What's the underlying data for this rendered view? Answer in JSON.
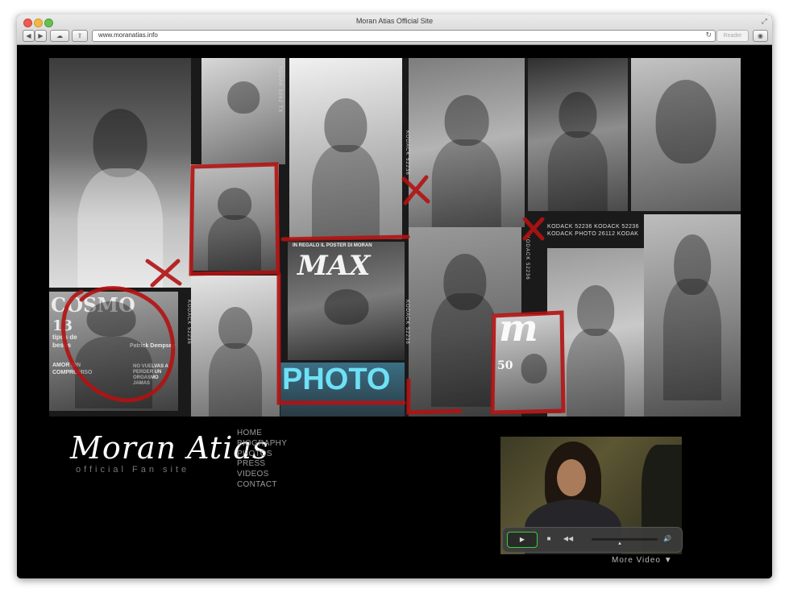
{
  "window": {
    "title": "Moran Atias Official Site",
    "url": "www.moranatias.info",
    "reader_label": "Reader",
    "toolbar_back": "◀",
    "toolbar_forward": "▶",
    "toolbar_cloud": "☁",
    "toolbar_share": "⇪",
    "reload_icon": "↻",
    "fullscreen_icon": "⤢",
    "downloads_icon": "◉"
  },
  "collage": {
    "magazine_max_banner": "IN REGALO IL POSTER DI MORAN",
    "magazine_max_title": "MAX",
    "magazine_cosmo_title": "COSMO",
    "magazine_cosmo_number": "13",
    "magazine_cosmo_line1": "tipos de",
    "magazine_cosmo_line2": "besos",
    "magazine_cosmo_line3": "AMOR SIN",
    "magazine_cosmo_line4": "COMPROMISO",
    "magazine_cosmo_line5": "Patrick Dempsey",
    "magazine_cosmo_line6": "NO VUELVAS A PERDER UN ORGASMO JAMAS",
    "magazine_photo_title": "PHOTO",
    "magazine_m_title": "m",
    "magazine_m_number": "50",
    "kodak_line1": "KODACK 52236 KODACK 52236",
    "kodak_line2": "KODACK PHOTO 26112 KODAK",
    "film_text": "KODACK 52236",
    "film_text_2": "KODAK 5062 TX",
    "film_text_3": "KODACK 52236"
  },
  "site": {
    "logo": "Moran Atias",
    "tagline": "official Fan site"
  },
  "nav": {
    "items": [
      "HOME",
      "BIOGRAPHY",
      "PHOTOS",
      "PRESS",
      "VIDEOS",
      "CONTACT"
    ]
  },
  "video": {
    "play_icon": "▶",
    "stop_icon": "■",
    "rewind_icon": "◀◀",
    "volume_icon": "🔊",
    "more_label": "More Video"
  },
  "colors": {
    "marker_red": "#b31212",
    "background": "#000000",
    "nav_text": "#9a9a9a",
    "play_border": "#36d136"
  }
}
